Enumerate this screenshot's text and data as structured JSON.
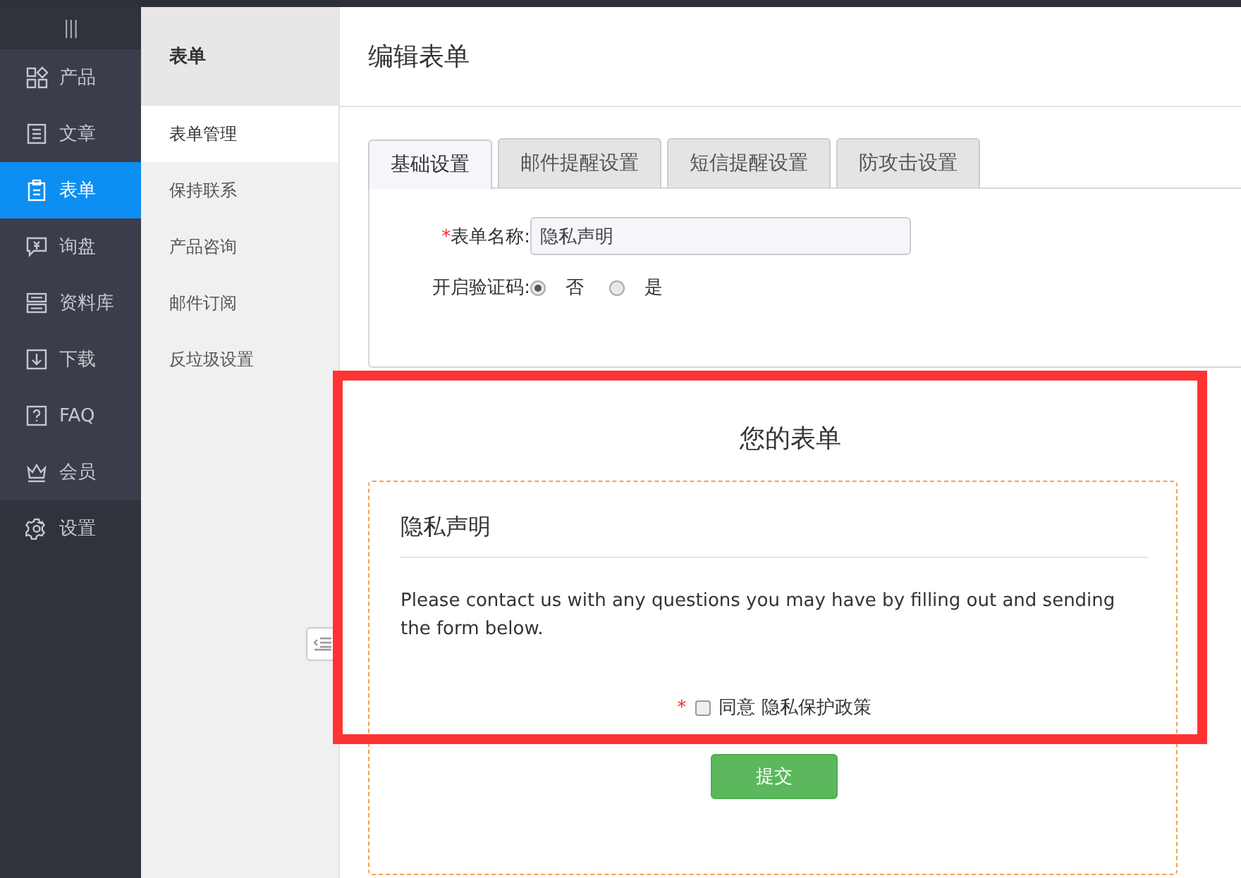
{
  "sidebar": {
    "toggle": "|||",
    "items": [
      {
        "label": "产品",
        "selected": false
      },
      {
        "label": "文章",
        "selected": false
      },
      {
        "label": "表单",
        "selected": true
      },
      {
        "label": "询盘",
        "selected": false
      },
      {
        "label": "资料库",
        "selected": false
      },
      {
        "label": "下载",
        "selected": false
      },
      {
        "label": "FAQ",
        "selected": false
      },
      {
        "label": "会员",
        "selected": false
      }
    ],
    "footer_item": {
      "label": "设置"
    }
  },
  "subnav": {
    "title": "表单",
    "items": [
      {
        "label": "表单管理",
        "selected": true
      },
      {
        "label": "保持联系",
        "selected": false
      },
      {
        "label": "产品咨询",
        "selected": false
      },
      {
        "label": "邮件订阅",
        "selected": false
      },
      {
        "label": "反垃圾设置",
        "selected": false
      }
    ]
  },
  "page_title": "编辑表单",
  "tabs": [
    {
      "label": "基础设置",
      "selected": true
    },
    {
      "label": "邮件提醒设置",
      "selected": false
    },
    {
      "label": "短信提醒设置",
      "selected": false
    },
    {
      "label": "防攻击设置",
      "selected": false
    }
  ],
  "settings": {
    "name_field": {
      "required_mark": "*",
      "label": "表单名称:",
      "value": "隐私声明"
    },
    "captcha": {
      "label": "开启验证码:",
      "options": [
        {
          "label": "否",
          "selected": true
        },
        {
          "label": "是",
          "selected": false
        }
      ]
    }
  },
  "preview": {
    "heading": "您的表单",
    "form_title": "隐私声明",
    "description": "Please contact us with any questions you may have by filling out and sending the form below.",
    "consent": {
      "required_mark": "*",
      "checked": false,
      "label": "同意 隐私保护政策"
    },
    "submit": "提交"
  }
}
